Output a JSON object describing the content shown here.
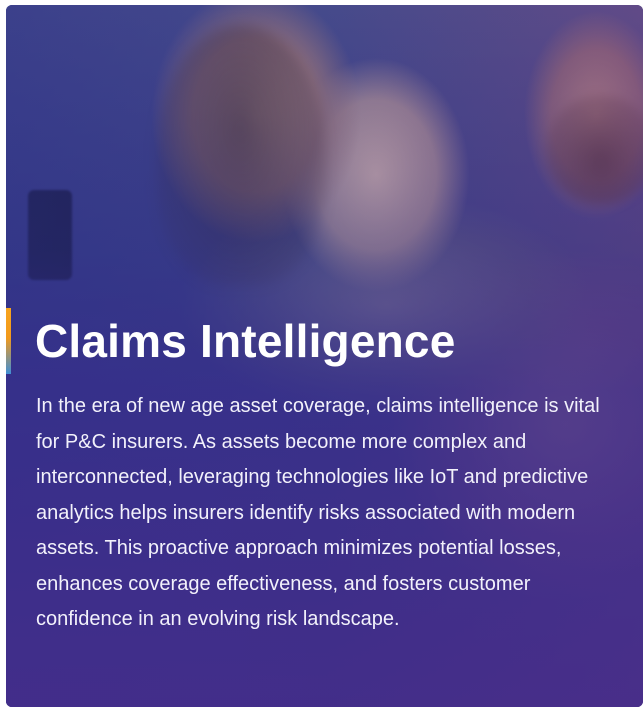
{
  "card": {
    "title": "Claims Intelligence",
    "description": "In the era of new age asset coverage, claims intelligence is vital for P&C insurers. As assets become more complex and interconnected, leveraging technologies like IoT and predictive analytics helps insurers identify risks associated with modern assets. This proactive approach minimizes potential losses, enhances coverage effectiveness, and fosters customer confidence in an evolving risk landscape.",
    "background_image": "family-with-baby-photo",
    "accent_colors": [
      "#f7a41d",
      "#3f8fd6"
    ],
    "overlay_color": "#2d3087"
  }
}
